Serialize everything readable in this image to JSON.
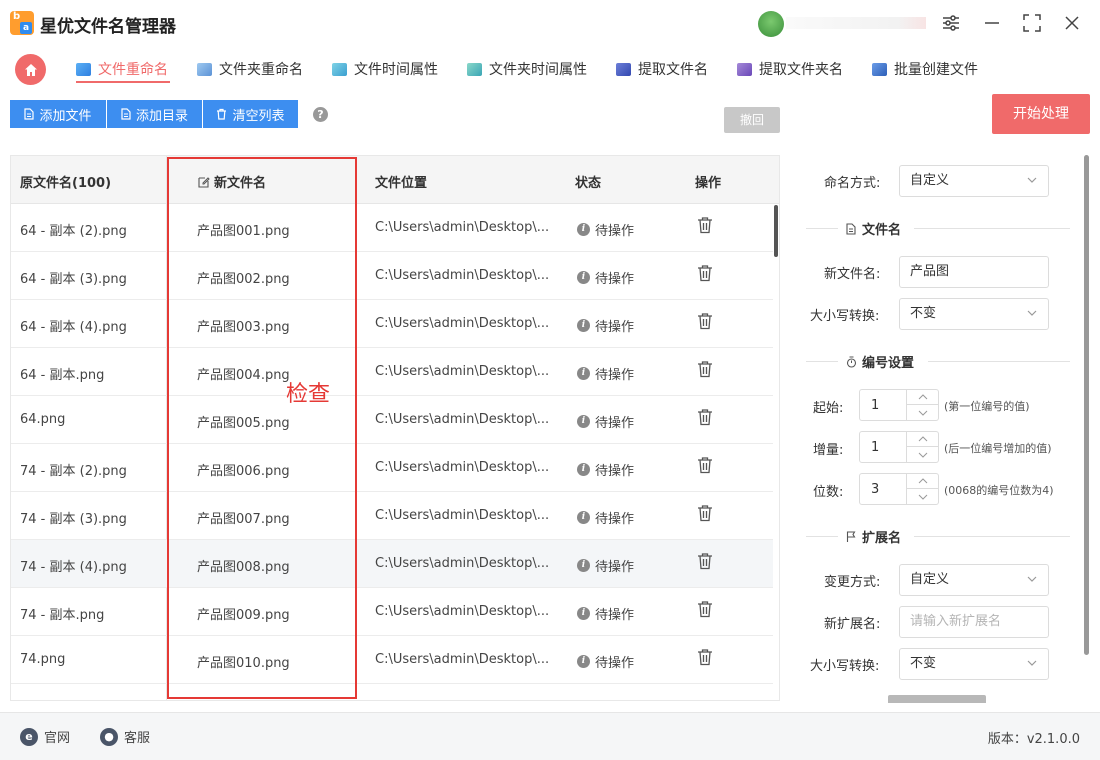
{
  "app": {
    "title": "星优文件名管理器",
    "logo_letters": [
      "b",
      "a"
    ]
  },
  "window_controls": [
    "settings-icon",
    "minimize-icon",
    "maximize-icon",
    "close-icon"
  ],
  "tabs": [
    {
      "label": "文件重命名",
      "active": true,
      "icon": "file-rename-icon"
    },
    {
      "label": "文件夹重命名",
      "icon": "folder-rename-icon"
    },
    {
      "label": "文件时间属性",
      "icon": "file-time-icon"
    },
    {
      "label": "文件夹时间属性",
      "icon": "folder-time-icon"
    },
    {
      "label": "提取文件名",
      "icon": "extract-filename-icon"
    },
    {
      "label": "提取文件夹名",
      "icon": "extract-foldername-icon"
    },
    {
      "label": "批量创建文件",
      "icon": "batch-create-icon"
    }
  ],
  "toolbar": {
    "add_file": "添加文件",
    "add_dir": "添加目录",
    "clear_list": "清空列表",
    "help": "?",
    "undo": "撤回",
    "start": "开始处理"
  },
  "table": {
    "headers": {
      "original": "原文件名(100)",
      "new": "新文件名",
      "location": "文件位置",
      "status": "状态",
      "action": "操作"
    },
    "rows": [
      {
        "original": "64 - 副本 (2).png",
        "new": "产品图001.png",
        "location": "C:\\Users\\admin\\Desktop\\...",
        "status": "待操作"
      },
      {
        "original": "64 - 副本 (3).png",
        "new": "产品图002.png",
        "location": "C:\\Users\\admin\\Desktop\\...",
        "status": "待操作"
      },
      {
        "original": "64 - 副本 (4).png",
        "new": "产品图003.png",
        "location": "C:\\Users\\admin\\Desktop\\...",
        "status": "待操作"
      },
      {
        "original": "64 - 副本.png",
        "new": "产品图004.png",
        "location": "C:\\Users\\admin\\Desktop\\...",
        "status": "待操作"
      },
      {
        "original": "64.png",
        "new": "产品图005.png",
        "location": "C:\\Users\\admin\\Desktop\\...",
        "status": "待操作"
      },
      {
        "original": "74 - 副本 (2).png",
        "new": "产品图006.png",
        "location": "C:\\Users\\admin\\Desktop\\...",
        "status": "待操作"
      },
      {
        "original": "74 - 副本 (3).png",
        "new": "产品图007.png",
        "location": "C:\\Users\\admin\\Desktop\\...",
        "status": "待操作"
      },
      {
        "original": "74 - 副本 (4).png",
        "new": "产品图008.png",
        "location": "C:\\Users\\admin\\Desktop\\...",
        "status": "待操作",
        "highlighted": true
      },
      {
        "original": "74 - 副本.png",
        "new": "产品图009.png",
        "location": "C:\\Users\\admin\\Desktop\\...",
        "status": "待操作"
      },
      {
        "original": "74.png",
        "new": "产品图010.png",
        "location": "C:\\Users\\admin\\Desktop\\...",
        "status": "待操作"
      }
    ]
  },
  "annotation": {
    "label": "检查",
    "color": "#e53935"
  },
  "panel": {
    "naming_method_label": "命名方式:",
    "naming_method_value": "自定义",
    "filename_section": "文件名",
    "new_name_label": "新文件名:",
    "new_name_value": "产品图",
    "case_label": "大小写转换:",
    "case_value": "不变",
    "numbering_section": "编号设置",
    "start_label": "起始:",
    "start_value": "1",
    "start_hint": "(第一位编号的值)",
    "step_label": "增量:",
    "step_value": "1",
    "step_hint": "(后一位编号增加的值)",
    "digits_label": "位数:",
    "digits_value": "3",
    "digits_hint": "(0068的编号位数为4)",
    "ext_section": "扩展名",
    "ext_method_label": "变更方式:",
    "ext_method_value": "自定义",
    "new_ext_label": "新扩展名:",
    "new_ext_placeholder": "请输入新扩展名",
    "ext_case_label": "大小写转换:",
    "ext_case_value": "不变"
  },
  "footer": {
    "website": "官网",
    "support": "客服",
    "version": "版本：v2.1.0.0"
  },
  "colors": {
    "accent": "#f06a6a",
    "primary": "#3d8ef0",
    "annotation": "#e53935"
  }
}
